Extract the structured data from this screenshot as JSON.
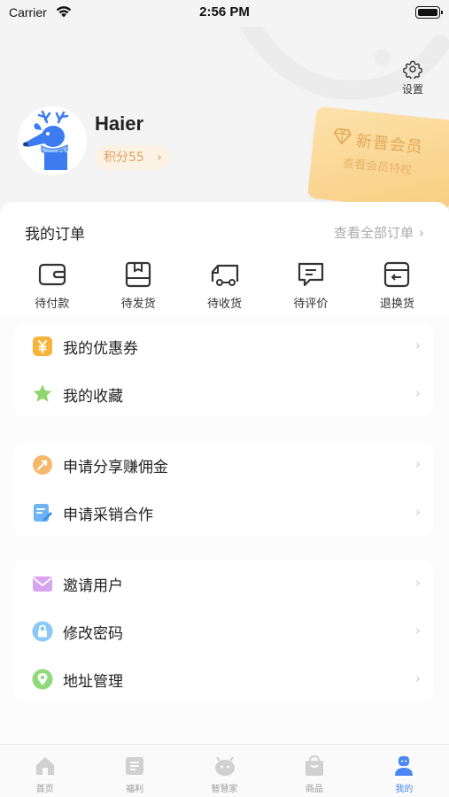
{
  "status_bar": {
    "carrier": "Carrier",
    "time": "2:56 PM"
  },
  "header": {
    "settings_label": "设置",
    "username": "Haier",
    "points": "积分55",
    "vip": {
      "title": "新晋会员",
      "subtitle": "查看会员特权"
    }
  },
  "orders": {
    "title": "我的订单",
    "view_all": "查看全部订单",
    "items": [
      {
        "label": "待付款",
        "icon": "wallet-icon"
      },
      {
        "label": "待发货",
        "icon": "package-icon"
      },
      {
        "label": "待收货",
        "icon": "truck-icon"
      },
      {
        "label": "待评价",
        "icon": "comment-icon"
      },
      {
        "label": "退换货",
        "icon": "return-box-icon"
      }
    ]
  },
  "menu": {
    "group1": [
      {
        "label": "我的优惠券",
        "icon": "coupon-icon"
      },
      {
        "label": "我的收藏",
        "icon": "star-icon"
      }
    ],
    "group2": [
      {
        "label": "申请分享赚佣金",
        "icon": "share-commission-icon"
      },
      {
        "label": "申请采销合作",
        "icon": "cooperation-icon"
      }
    ],
    "group3": [
      {
        "label": "邀请用户",
        "icon": "invite-envelope-icon"
      },
      {
        "label": "修改密码",
        "icon": "lock-icon"
      },
      {
        "label": "地址管理",
        "icon": "location-pin-icon"
      }
    ]
  },
  "tabbar": {
    "active_index": 4,
    "items": [
      {
        "label": "首页",
        "icon": "home-icon"
      },
      {
        "label": "福利",
        "icon": "welfare-icon"
      },
      {
        "label": "智慧家",
        "icon": "smart-home-icon"
      },
      {
        "label": "商品",
        "icon": "shopping-bag-icon"
      },
      {
        "label": "我的",
        "icon": "profile-icon"
      }
    ]
  },
  "colors": {
    "accent": "#4a86f5",
    "vip_gold": "#e4a95a",
    "points_text": "#e0a15c"
  }
}
